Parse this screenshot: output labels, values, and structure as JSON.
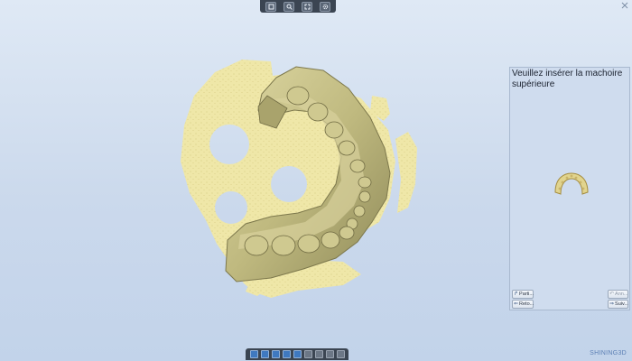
{
  "top_toolbar": {
    "buttons": [
      {
        "icon": "square-icon"
      },
      {
        "icon": "zoom-icon"
      },
      {
        "icon": "fit-view-icon"
      },
      {
        "icon": "settings-icon"
      }
    ]
  },
  "window": {
    "close_icon": "close-icon"
  },
  "panel": {
    "title": "Veuillez insérer la machoire supérieure",
    "preview_icon": "jaw-preview-icon",
    "buttons": {
      "partial": "Parti...",
      "return": "Reto...",
      "cancel": "Ann...",
      "next": "Suiv..."
    }
  },
  "bottom_toolbar": {
    "buttons": [
      {
        "icon": "view-front-icon"
      },
      {
        "icon": "view-back-icon"
      },
      {
        "icon": "view-left-icon"
      },
      {
        "icon": "view-right-icon"
      },
      {
        "icon": "view-top-icon"
      },
      {
        "icon": "view-bottom-icon"
      },
      {
        "icon": "texture-icon"
      },
      {
        "icon": "mesh-icon"
      },
      {
        "icon": "measure-icon"
      }
    ]
  },
  "branding": {
    "text": "SHINING3D"
  },
  "colors": {
    "background": "#cbd9ec",
    "model": "#c9c48e",
    "plate": "#efe7a8",
    "toolbar": "#3b4552",
    "brand": "#5b7fb4"
  }
}
